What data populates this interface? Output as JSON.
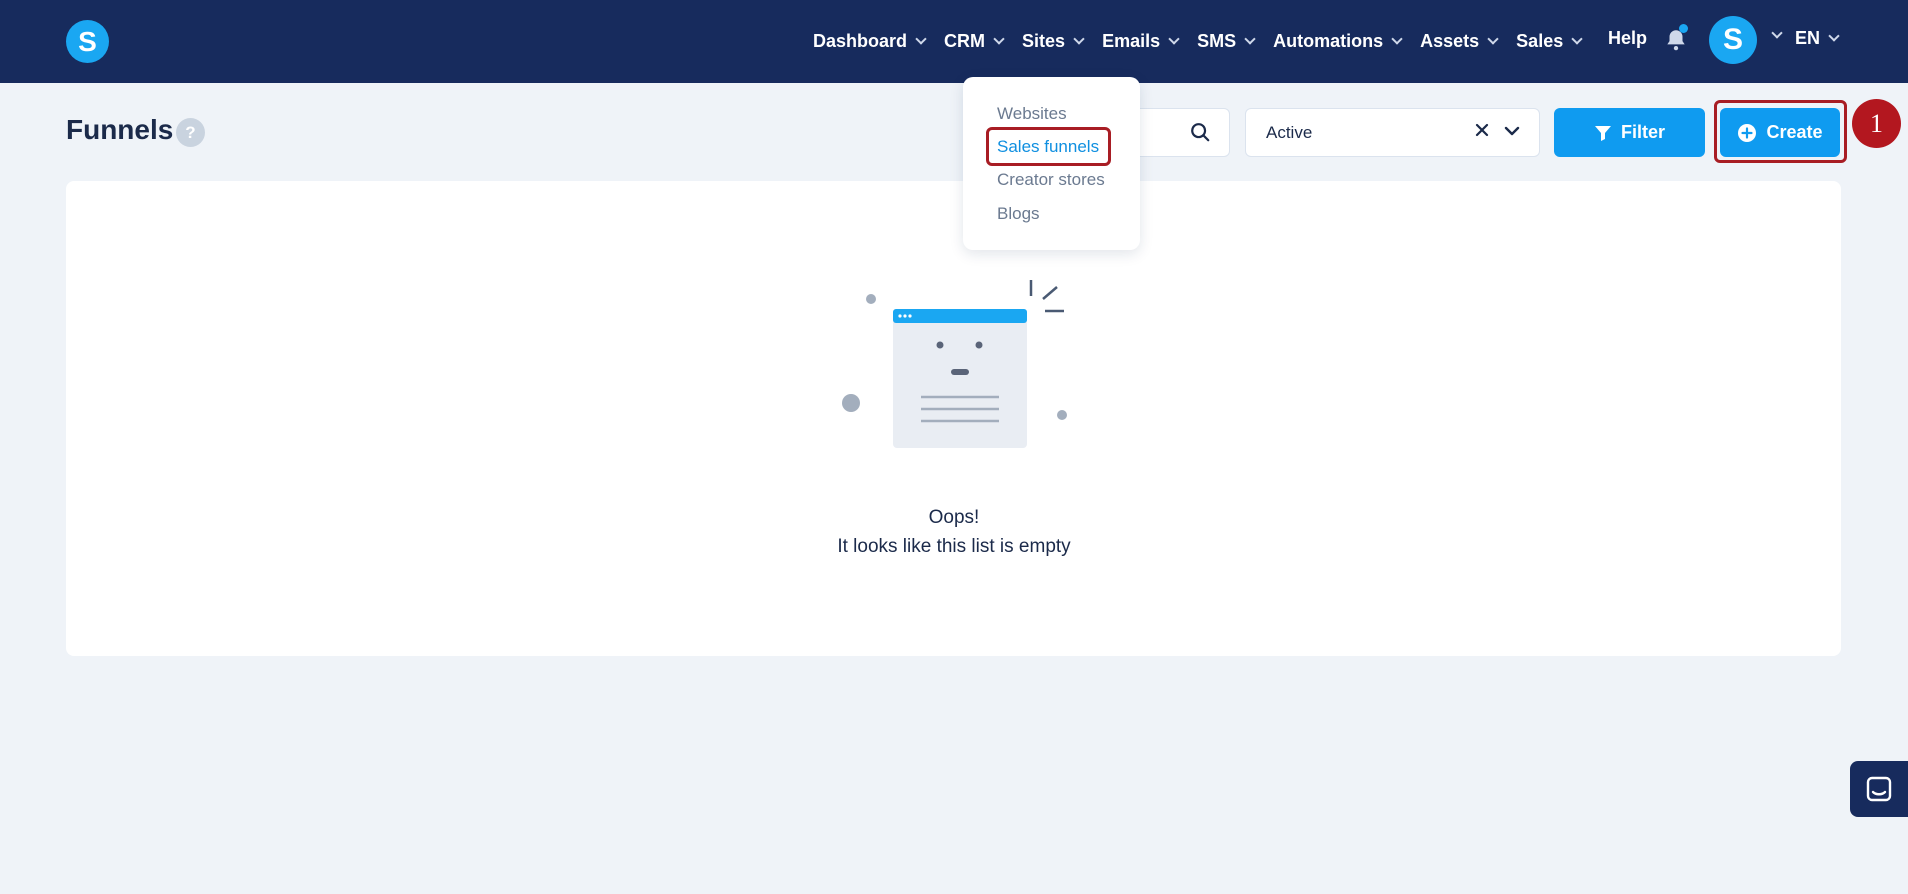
{
  "app": {
    "logo_letter": "S",
    "brand_color": "#1aa7f2",
    "nav_bg": "#172b5d"
  },
  "nav": {
    "items": [
      {
        "label": "Dashboard"
      },
      {
        "label": "CRM"
      },
      {
        "label": "Sites"
      },
      {
        "label": "Emails"
      },
      {
        "label": "SMS"
      },
      {
        "label": "Automations"
      },
      {
        "label": "Assets"
      },
      {
        "label": "Sales"
      }
    ],
    "help_label": "Help",
    "avatar_letter": "S",
    "language": "EN"
  },
  "sites_menu": {
    "items": [
      {
        "label": "Websites"
      },
      {
        "label": "Sales funnels"
      },
      {
        "label": "Creator stores"
      },
      {
        "label": "Blogs"
      }
    ],
    "highlighted": "Sales funnels"
  },
  "page": {
    "title": "Funnels",
    "help_badge": "?"
  },
  "toolbar": {
    "status_filter_value": "Active",
    "filter_label": "Filter",
    "create_label": "Create"
  },
  "empty_state": {
    "title": "Oops!",
    "subtitle": "It looks like this list is empty"
  },
  "annotation": {
    "step_number": "1",
    "highlight_color": "#a81d24"
  }
}
